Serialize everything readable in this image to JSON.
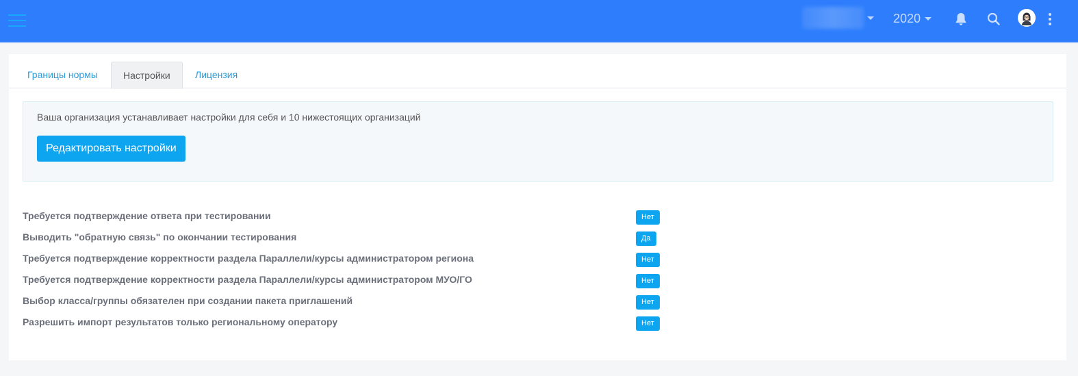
{
  "header": {
    "year": "2020",
    "icons": [
      "menu-icon",
      "bell-icon",
      "search-icon",
      "avatar",
      "more-vert-icon"
    ]
  },
  "tabs": [
    {
      "label": "Границы нормы",
      "active": false
    },
    {
      "label": "Настройки",
      "active": true
    },
    {
      "label": "Лицензия",
      "active": false
    }
  ],
  "info": {
    "text": "Ваша организация устанавливает настройки для себя и 10 нижестоящих организаций",
    "button": "Редактировать настройки"
  },
  "settings": [
    {
      "label": "Требуется подтверждение ответа при тестировании",
      "value": "Нет"
    },
    {
      "label": "Выводить \"обратную связь\" по окончании тестирования",
      "value": "Да"
    },
    {
      "label": "Требуется подтверждение корректности раздела Параллели/курсы администратором региона",
      "value": "Нет"
    },
    {
      "label": "Требуется подтверждение корректности раздела Параллели/курсы администратором МУО/ГО",
      "value": "Нет"
    },
    {
      "label": "Выбор класса/группы обязателен при создании пакета приглашений",
      "value": "Нет"
    },
    {
      "label": "Разрешить импорт результатов только региональному оператору",
      "value": "Нет"
    }
  ],
  "colors": {
    "topbar": "#2d7dfc",
    "accent": "#0da4f0",
    "link": "#2d9cdb"
  }
}
